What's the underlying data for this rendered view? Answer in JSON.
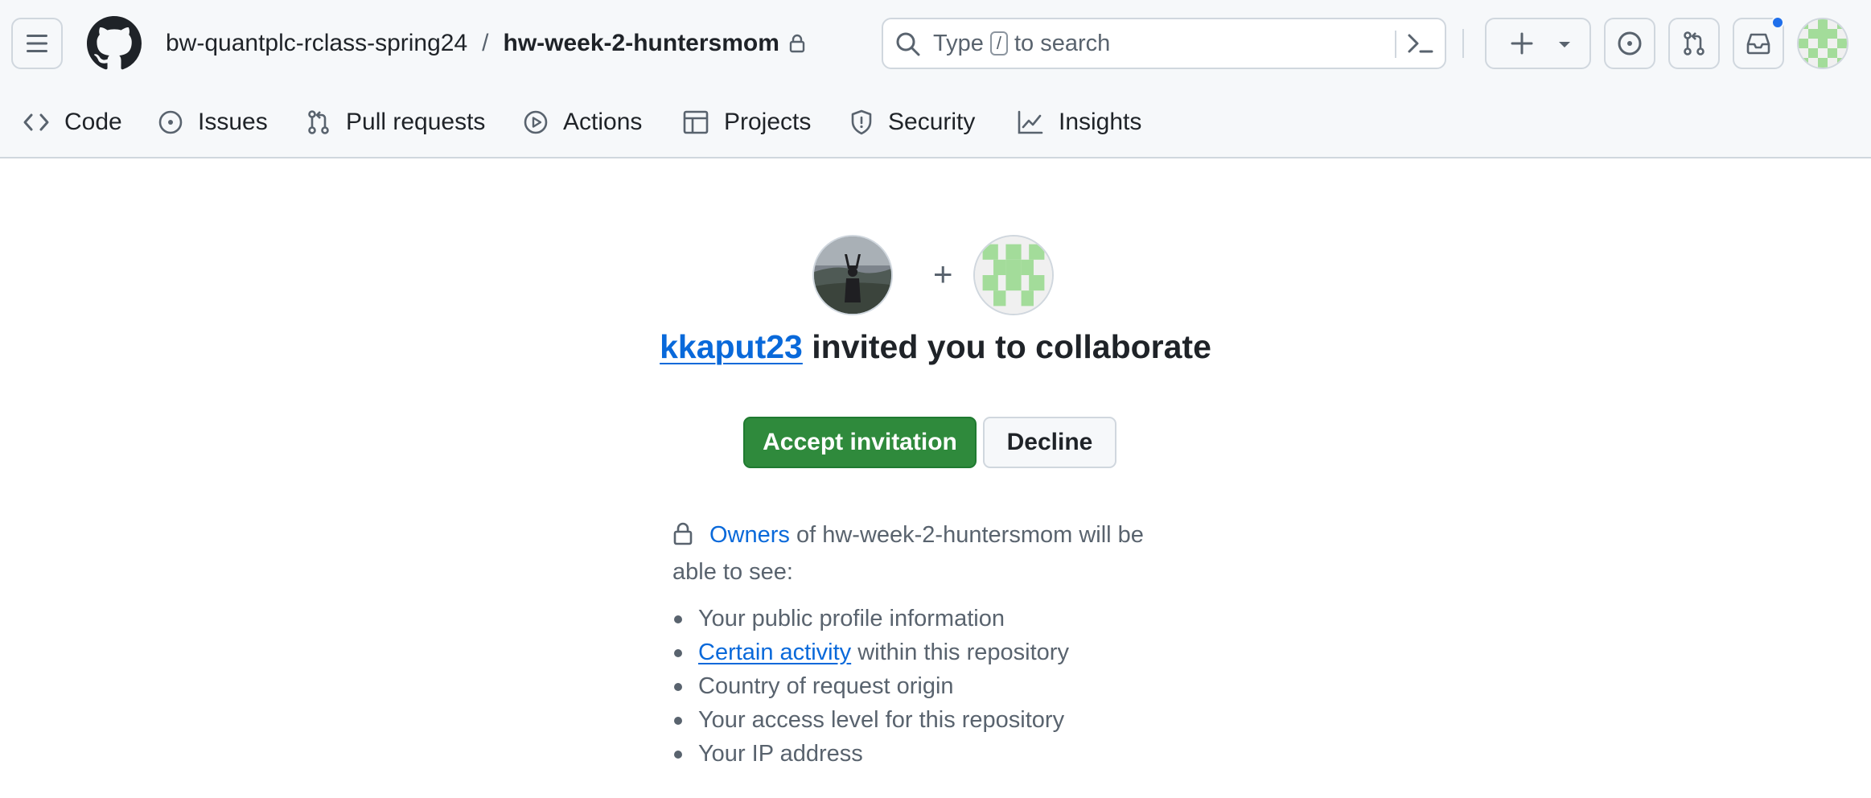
{
  "topbar": {
    "owner": "bw-quantplc-rclass-spring24",
    "separator": "/",
    "repo": "hw-week-2-huntersmom",
    "search": {
      "before": "Type",
      "key": "/",
      "after": "to search"
    }
  },
  "nav": [
    {
      "label": "Code",
      "icon": "code-icon"
    },
    {
      "label": "Issues",
      "icon": "issue-icon"
    },
    {
      "label": "Pull requests",
      "icon": "pull-request-icon"
    },
    {
      "label": "Actions",
      "icon": "play-icon"
    },
    {
      "label": "Projects",
      "icon": "table-icon"
    },
    {
      "label": "Security",
      "icon": "shield-icon"
    },
    {
      "label": "Insights",
      "icon": "graph-icon"
    }
  ],
  "invite": {
    "plus": "+",
    "inviter": "kkaput23",
    "headline_rest": " invited you to collaborate",
    "accept_label": "Accept invitation",
    "decline_label": "Decline",
    "owners_link": "Owners",
    "owners_rest_1": " of hw-week-2-huntersmom will be",
    "owners_rest_2": "able to see:",
    "items": [
      {
        "text": "Your public profile information"
      },
      {
        "link": "Certain activity",
        "text": " within this repository"
      },
      {
        "text": "Country of request origin"
      },
      {
        "text": "Your access level for this repository"
      },
      {
        "text": "Your IP address"
      }
    ]
  },
  "colors": {
    "accent": "#0969da",
    "accept_green": "#2f8a3c",
    "notification": "#1f6feb"
  }
}
